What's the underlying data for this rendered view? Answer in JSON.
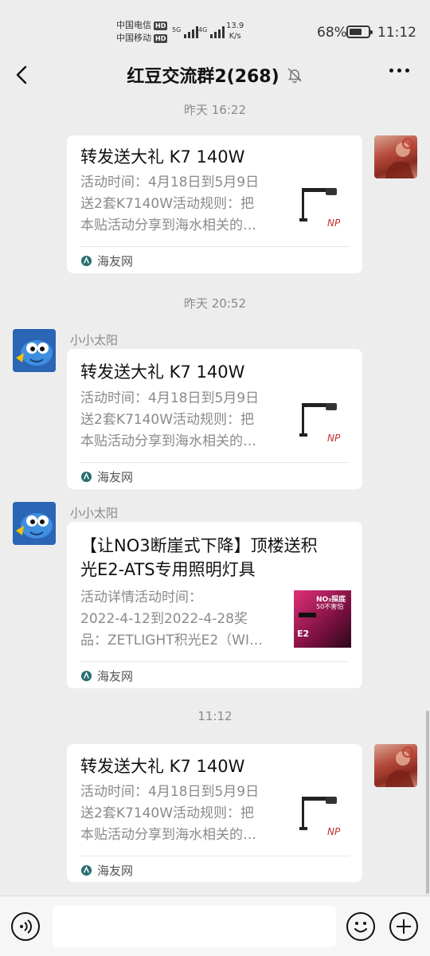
{
  "status_bar": {
    "carrier1": "中国电信",
    "carrier2": "中国移动",
    "hd": "HD",
    "sig1": "5G",
    "sig2": "4G",
    "speed_value": "13.9",
    "speed_unit": "K/s",
    "battery_pct": "68%",
    "battery_level": 0.68,
    "time": "11:12"
  },
  "header": {
    "title": "红豆交流群2(268)",
    "back_icon": "back-chevron-icon",
    "mute_icon": "bell-muted-icon",
    "more_icon": "more-dots-icon"
  },
  "messages": [
    {
      "timestamp": "昨天 16:22",
      "card_title": "转发送大礼 K7 140W",
      "desc_lines": [
        "活动时间：4月18日到5月9日",
        "送2套K7140W活动规则：把",
        "本贴活动分享到海水相关的…"
      ],
      "source": "海友网"
    },
    {
      "timestamp": "昨天 20:52",
      "sender": "小小太阳",
      "card_title": "转发送大礼 K7 140W",
      "desc_lines": [
        "活动时间：4月18日到5月9日",
        "送2套K7140W活动规则：把",
        "本贴活动分享到海水相关的…"
      ],
      "source": "海友网"
    },
    {
      "sender": "小小太阳",
      "card_title_lines": [
        "【让NO3断崖式下降】顶楼送积",
        "光E2-ATS专用照明灯具"
      ],
      "desc_lines": [
        "活动详情活动时间：",
        "2022-4-12到2022-4-28奖",
        "品：ZETLIGHT积光E2（WI…"
      ],
      "source": "海友网",
      "thumb_text1": "NO₃探底",
      "thumb_text2": "50不害怕",
      "thumb_text3": "E2"
    },
    {
      "timestamp": "11:12",
      "card_title": "转发送大礼 K7 140W",
      "desc_lines": [
        "活动时间：4月18日到5月9日",
        "送2套K7140W活动规则：把",
        "本贴活动分享到海水相关的…"
      ],
      "source": "海友网"
    }
  ],
  "input_bar": {
    "voice_icon": "voice-icon",
    "emoji_icon": "emoji-icon",
    "plus_icon": "plus-icon",
    "placeholder": ""
  }
}
